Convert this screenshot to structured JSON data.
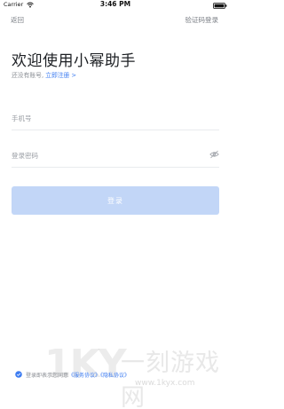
{
  "status_bar": {
    "carrier": "Carrier",
    "time": "3:46 PM"
  },
  "nav": {
    "back_label": "返回",
    "sms_login_label": "验证码登录"
  },
  "header": {
    "title": "欢迎使用小幂助手",
    "no_account_text": "还没有账号,",
    "register_link": "立即注册",
    "chevron": ">"
  },
  "form": {
    "phone_placeholder": "手机号",
    "password_placeholder": "登录密码",
    "login_label": "登录"
  },
  "agreement": {
    "text": "登录即表示您同意",
    "service_link": "《服务协议》",
    "privacy_link": "《隐私协议》"
  },
  "watermark": {
    "logo": "1KY",
    "site_name": "一刻游戏网",
    "url": "www.1kyx.com"
  },
  "colors": {
    "accent": "#3d7cf1",
    "button_disabled": "#c2d6f7",
    "muted_text": "#8a8e94"
  },
  "icons": {
    "wifi": "wifi-icon",
    "battery": "battery-icon",
    "password_toggle": "eye-slash-icon",
    "agreement_check": "check-circle-icon"
  }
}
